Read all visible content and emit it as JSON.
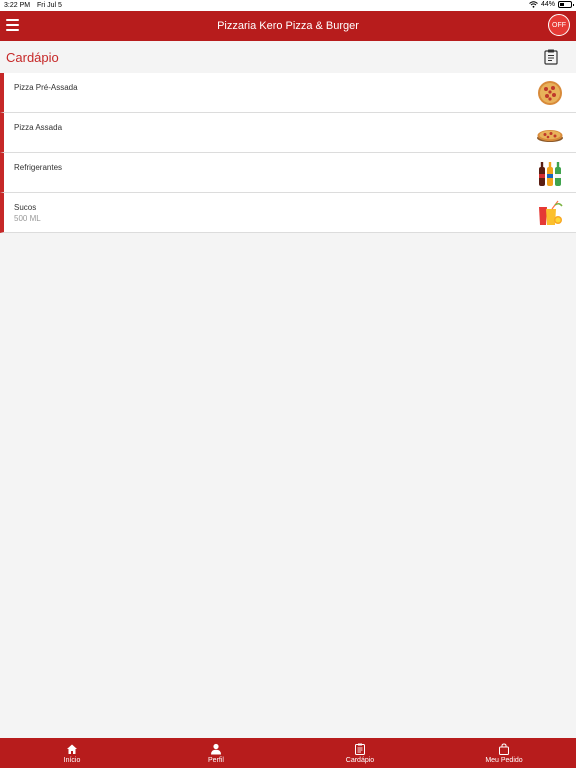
{
  "status_bar": {
    "time": "3:22 PM",
    "date": "Fri Jul 5",
    "battery": "44%",
    "battery_level": 0.44
  },
  "header": {
    "title": "Pizzaria Kero Pizza & Burger",
    "status_badge": "OFF"
  },
  "page": {
    "title": "Cardápio"
  },
  "menu": [
    {
      "name": "Pizza Pré-Assada",
      "subtitle": "",
      "icon": "pizza-top-icon"
    },
    {
      "name": "Pizza Assada",
      "subtitle": "",
      "icon": "pizza-side-icon"
    },
    {
      "name": "Refrigerantes",
      "subtitle": "",
      "icon": "soda-bottles-icon"
    },
    {
      "name": "Sucos",
      "subtitle": "500 ML",
      "icon": "juice-icon"
    }
  ],
  "tabs": [
    {
      "label": "Início",
      "icon": "home-icon"
    },
    {
      "label": "Perfil",
      "icon": "person-icon"
    },
    {
      "label": "Cardápio",
      "icon": "clipboard-icon"
    },
    {
      "label": "Meu Pedido",
      "icon": "shopping-bag-icon"
    }
  ],
  "colors": {
    "primary": "#b71c1c",
    "accent": "#c62828",
    "background": "#f4f4f4"
  }
}
